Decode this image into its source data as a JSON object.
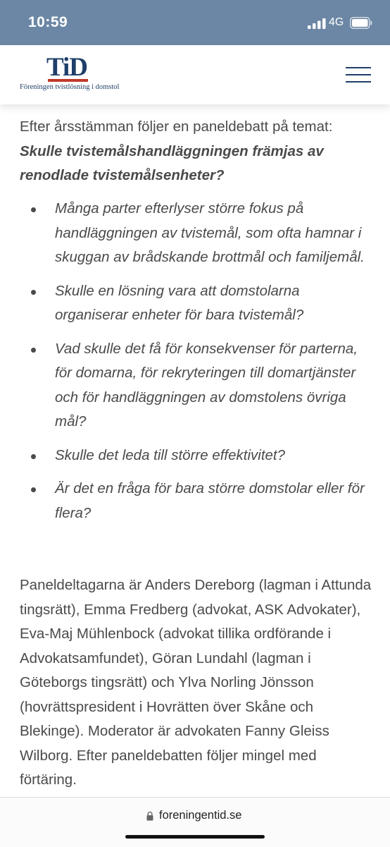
{
  "status_bar": {
    "time": "10:59",
    "network": "4G"
  },
  "header": {
    "logo_text": "TiD",
    "logo_subtitle": "Föreningen tvistlösning i domstol",
    "logo_color": "#1f3f6a",
    "logo_accent": "#c0392b"
  },
  "article": {
    "intro_plain": "Efter årsstämman följer en paneldebatt på temat: ",
    "intro_emphasis": "Skulle tvistemålshandläggningen främjas av renodlade tvistemålsenheter?",
    "bullets": [
      "Många parter efterlyser större fokus på handläggningen av tvistemål, som ofta hamnar i skuggan av brådskande brottmål och familjemål.",
      "Skulle en lösning vara att domstolarna organiserar enheter för bara tvistemål?",
      "Vad skulle det få för konsekvenser för parterna, för domarna, för rekryteringen till domartjänster och för handläggningen av domstolens övriga mål?",
      "Skulle det leda till större effektivitet?",
      "Är det en fråga för bara större domstolar eller för flera?"
    ],
    "outro": "Paneldeltagarna är Anders Dereborg (lagman i Attunda tingsrätt), Emma Fredberg (advokat, ASK Advokater), Eva-Maj Mühlenbock (advokat tillika ordförande i Advokatsamfundet), Göran Lundahl (lagman i Göteborgs tingsrätt) och Ylva Norling Jönsson (hovrättspresident i Hovrätten över Skåne och Blekinge). Moderator är advokaten Fanny Gleiss Wilborg. Efter paneldebatten följer mingel med förtäring."
  },
  "browser": {
    "url": "foreningentid.se"
  },
  "colors": {
    "status_bar_bg": "#6b87a5",
    "text": "#4a4a4a"
  }
}
